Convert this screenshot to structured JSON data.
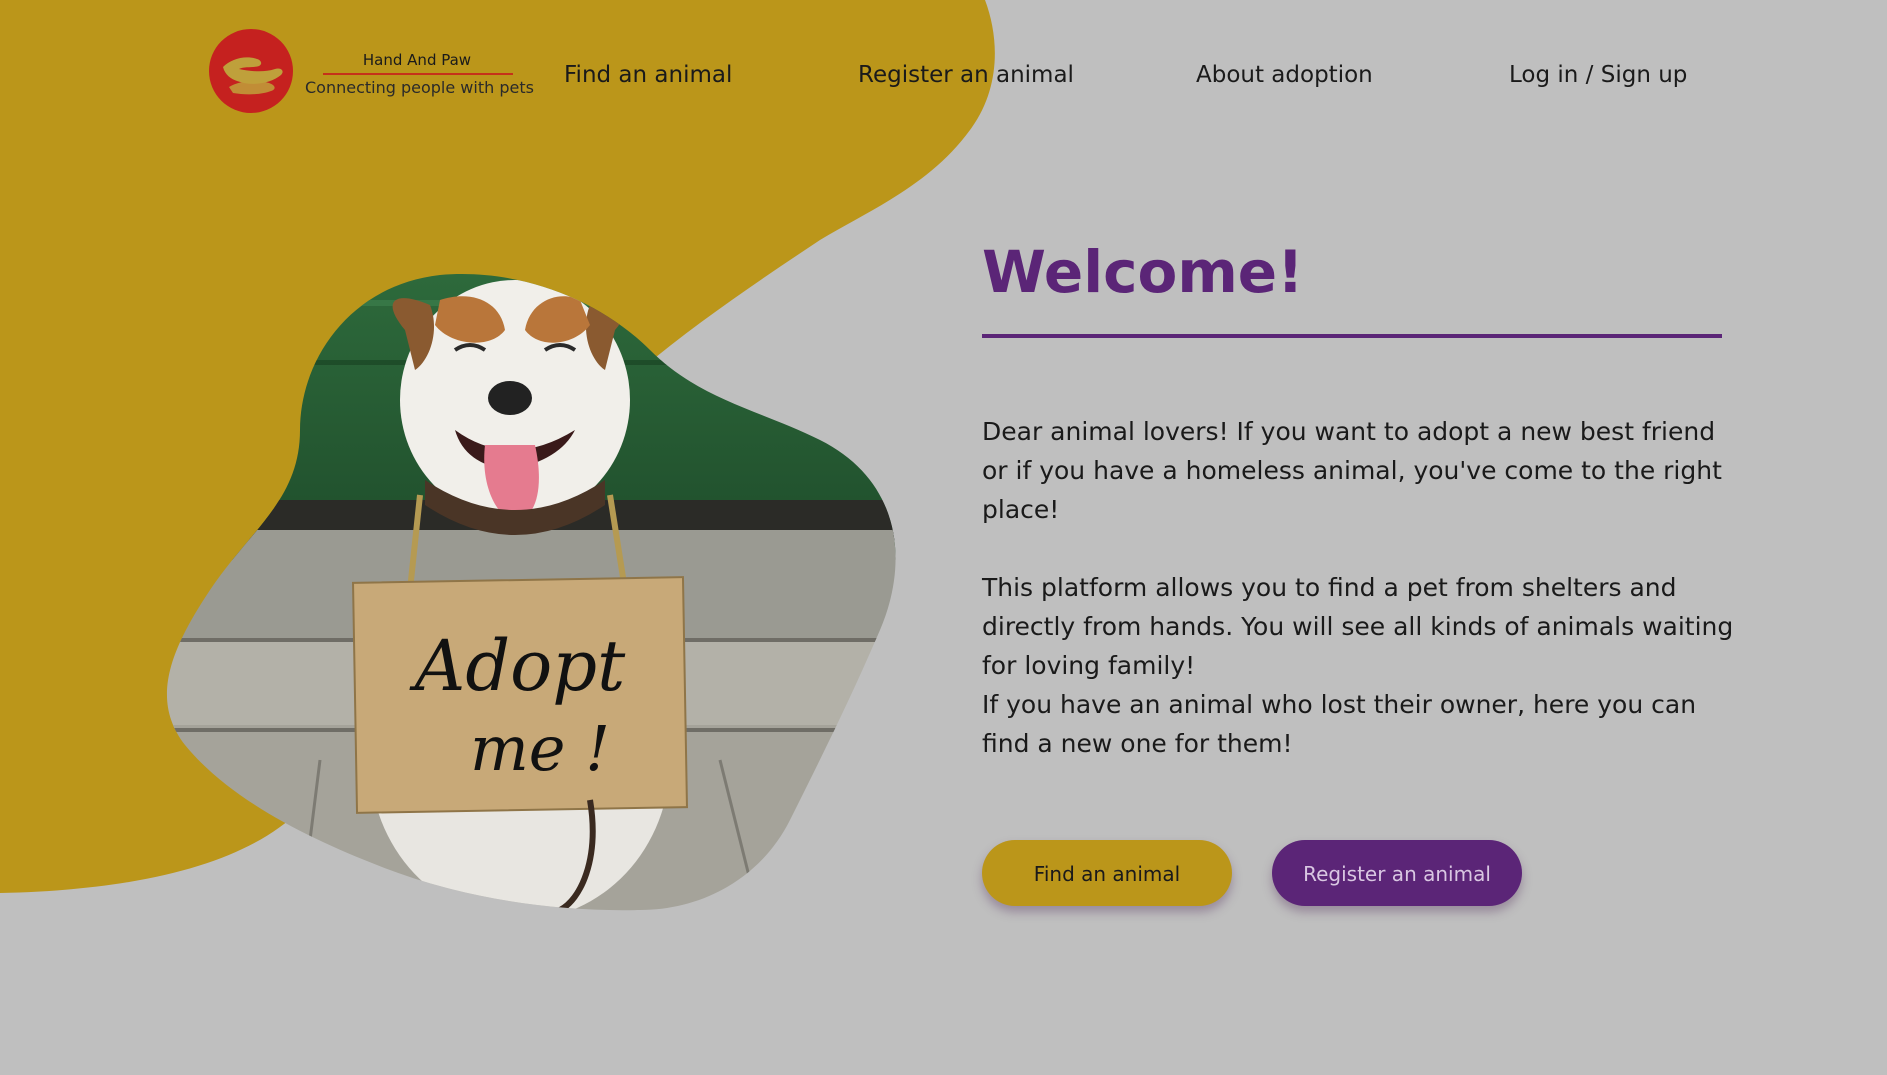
{
  "brand": {
    "name": "Hand And Paw",
    "tagline": "Connecting people with pets",
    "logo_icon": "hand-and-paw-logo-icon"
  },
  "nav": {
    "items": [
      {
        "label": "Find an animal"
      },
      {
        "label": "Register an animal"
      },
      {
        "label": "About adoption"
      },
      {
        "label": "Log in / Sign up"
      }
    ]
  },
  "hero": {
    "title": "Welcome!",
    "paragraph1": "Dear animal lovers! If you want to adopt a new best friend or if you have a homeless animal, you've come to the right place!",
    "paragraph2_line1": "This platform allows you to find a pet from shelters and directly from hands. You will see all kinds of animals waiting for loving family!",
    "paragraph2_line2": "If you have an animal who lost their owner, here you can find a new one for them!",
    "image_sign_text": "Adopt me!"
  },
  "buttons": {
    "find_label": "Find an animal",
    "register_label": "Register an animal"
  },
  "colors": {
    "background": "#bfbfbf",
    "mustard": "#bb961a",
    "purple": "#5b2577",
    "logo_red": "#c5211f"
  }
}
